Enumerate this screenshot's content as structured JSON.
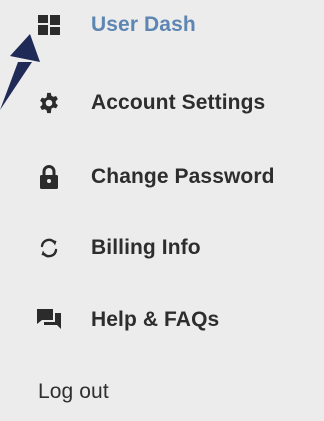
{
  "nav": {
    "items": [
      {
        "label": "User Dash",
        "icon": "dashboard-icon",
        "active": true
      },
      {
        "label": "Account Settings",
        "icon": "gear-icon",
        "active": false
      },
      {
        "label": "Change Password",
        "icon": "lock-icon",
        "active": false
      },
      {
        "label": "Billing Info",
        "icon": "refresh-icon",
        "active": false
      },
      {
        "label": "Help & FAQs",
        "icon": "chat-icon",
        "active": false
      }
    ],
    "logout_label": "Log out"
  },
  "colors": {
    "background": "#ececec",
    "active_text": "#5e86b2",
    "text": "#2d2d2d",
    "icon": "#2b2b2b",
    "arrow": "#1f2a56"
  }
}
